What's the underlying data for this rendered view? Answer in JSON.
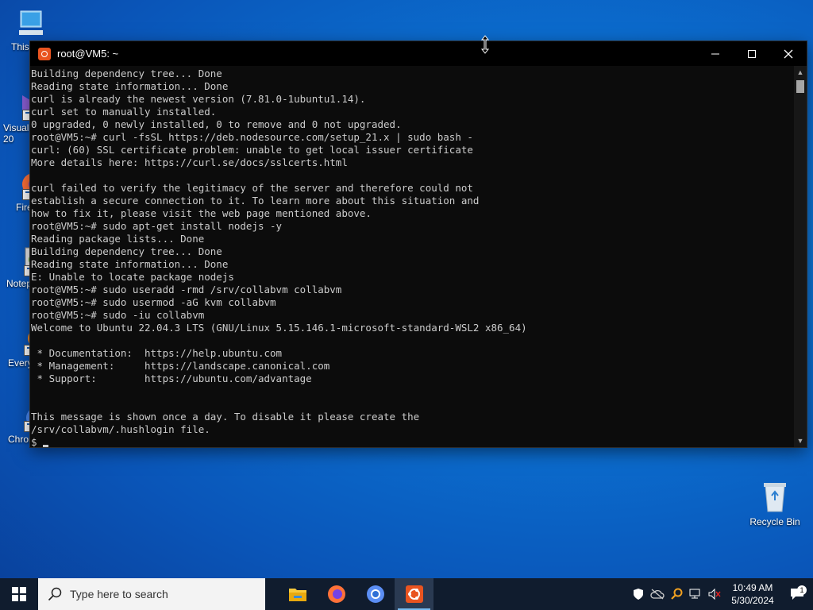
{
  "desktop": {
    "icons": [
      {
        "label": "This"
      },
      {
        "label": "Visual\n20"
      },
      {
        "label": "Firef"
      },
      {
        "label": "Notep"
      },
      {
        "label": "Every"
      },
      {
        "label": "Chrom"
      }
    ],
    "recycle_bin": {
      "label": "Recycle Bin"
    }
  },
  "terminal": {
    "title": "root@VM5: ~",
    "lines": [
      "Building dependency tree... Done",
      "Reading state information... Done",
      "curl is already the newest version (7.81.0-1ubuntu1.14).",
      "curl set to manually installed.",
      "0 upgraded, 0 newly installed, 0 to remove and 0 not upgraded.",
      "root@VM5:~# curl -fsSL https://deb.nodesource.com/setup_21.x | sudo bash -",
      "curl: (60) SSL certificate problem: unable to get local issuer certificate",
      "More details here: https://curl.se/docs/sslcerts.html",
      "",
      "curl failed to verify the legitimacy of the server and therefore could not",
      "establish a secure connection to it. To learn more about this situation and",
      "how to fix it, please visit the web page mentioned above.",
      "root@VM5:~# sudo apt-get install nodejs -y",
      "Reading package lists... Done",
      "Building dependency tree... Done",
      "Reading state information... Done",
      "E: Unable to locate package nodejs",
      "root@VM5:~# sudo useradd -rmd /srv/collabvm collabvm",
      "root@VM5:~# sudo usermod -aG kvm collabvm",
      "root@VM5:~# sudo -iu collabvm",
      "Welcome to Ubuntu 22.04.3 LTS (GNU/Linux 5.15.146.1-microsoft-standard-WSL2 x86_64)",
      "",
      " * Documentation:  https://help.ubuntu.com",
      " * Management:     https://landscape.canonical.com",
      " * Support:        https://ubuntu.com/advantage",
      "",
      "",
      "This message is shown once a day. To disable it please create the",
      "/srv/collabvm/.hushlogin file.",
      "$ "
    ],
    "colors": {
      "background": "#0c0c0c",
      "text": "#cccccc"
    }
  },
  "taskbar": {
    "search_placeholder": "Type here to search",
    "apps": [
      {
        "name": "file-explorer-icon"
      },
      {
        "name": "firefox-icon"
      },
      {
        "name": "chromium-icon"
      },
      {
        "name": "ubuntu-icon",
        "active": true
      }
    ],
    "clock": {
      "time": "10:49 AM",
      "date": "5/30/2024"
    },
    "notification_count": "1"
  }
}
